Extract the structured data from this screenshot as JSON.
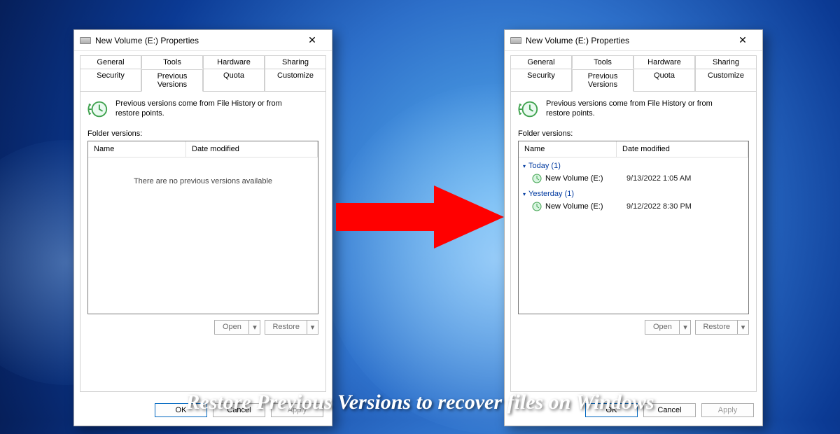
{
  "caption": "Restore Previous Versions to recover files on Windows",
  "window": {
    "title": "New Volume (E:) Properties",
    "tabs_row1": [
      "General",
      "Tools",
      "Hardware",
      "Sharing"
    ],
    "tabs_row2": [
      "Security",
      "Previous Versions",
      "Quota",
      "Customize"
    ],
    "active_tab": "Previous Versions",
    "description": "Previous versions come from File History or from restore points.",
    "folder_versions_label": "Folder versions:",
    "columns": {
      "name": "Name",
      "date": "Date modified"
    },
    "empty_message": "There are no previous versions available",
    "buttons": {
      "open": "Open",
      "restore": "Restore",
      "ok": "OK",
      "cancel": "Cancel",
      "apply": "Apply"
    }
  },
  "left_panel": {
    "has_versions": false
  },
  "right_panel": {
    "has_versions": true,
    "groups": [
      {
        "label": "Today (1)",
        "items": [
          {
            "name": "New Volume (E:)",
            "date": "9/13/2022 1:05 AM"
          }
        ]
      },
      {
        "label": "Yesterday (1)",
        "items": [
          {
            "name": "New Volume (E:)",
            "date": "9/12/2022 8:30 PM"
          }
        ]
      }
    ]
  }
}
